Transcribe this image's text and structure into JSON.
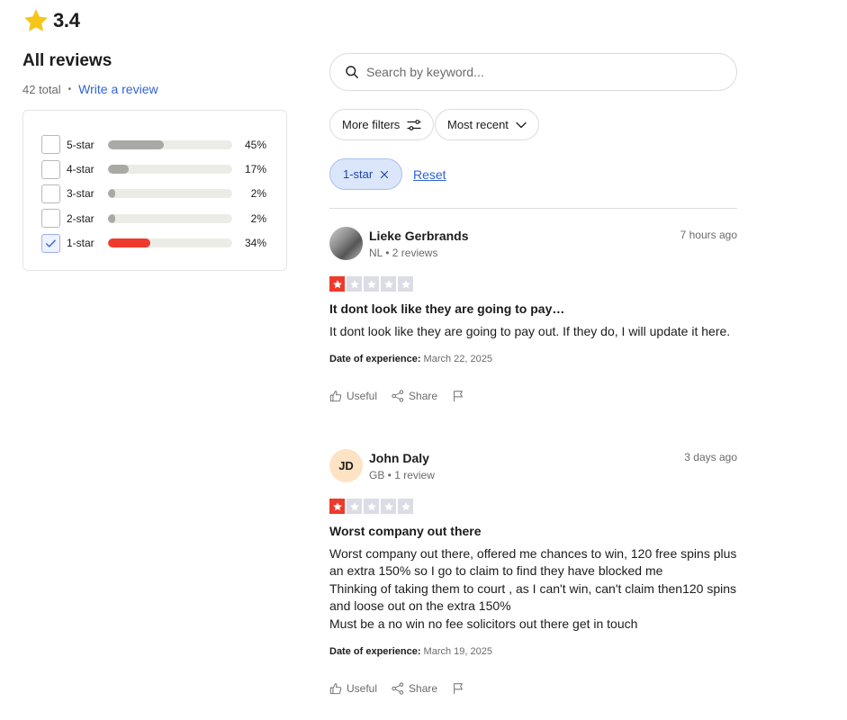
{
  "summary": {
    "rating": "3.4",
    "title": "All reviews",
    "total": "42 total",
    "separator": "•",
    "write_review": "Write a review"
  },
  "filters": [
    {
      "label": "5-star",
      "percent": "45%",
      "fill": 0.45,
      "checked": false
    },
    {
      "label": "4-star",
      "percent": "17%",
      "fill": 0.17,
      "checked": false
    },
    {
      "label": "3-star",
      "percent": "2%",
      "fill": 0.06,
      "checked": false
    },
    {
      "label": "2-star",
      "percent": "2%",
      "fill": 0.06,
      "checked": false
    },
    {
      "label": "1-star",
      "percent": "34%",
      "fill": 0.34,
      "checked": true
    }
  ],
  "search": {
    "placeholder": "Search by keyword..."
  },
  "controls": {
    "more_filters": "More filters",
    "sort": "Most recent",
    "active_chip": "1-star",
    "reset": "Reset"
  },
  "reviews": [
    {
      "name": "Lieke Gerbrands",
      "meta": "NL • 2 reviews",
      "time": "7 hours ago",
      "stars": 1,
      "title": "It dont look like they are going to pay…",
      "body": "It dont look like they are going to pay out. If they do, I will update it here.",
      "date_label": "Date of experience:",
      "date": "March 22, 2025",
      "useful": "Useful",
      "share": "Share"
    },
    {
      "name": "John Daly",
      "initials": "JD",
      "meta": "GB • 1 review",
      "time": "3 days ago",
      "stars": 1,
      "title": "Worst company out there",
      "body": "Worst company out there, offered me chances to win, 120 free spins plus an extra 150% so I go to claim to find they have blocked me\nThinking of taking them to court , as I can't win, can't claim then120 spins and loose out on the extra 150%\nMust be a no win no fee solicitors out there get in touch",
      "date_label": "Date of experience:",
      "date": "March 19, 2025",
      "useful": "Useful",
      "share": "Share"
    }
  ],
  "colors": {
    "accent_blue": "#2f63d6",
    "star_yellow": "#f5c518",
    "one_star_red": "#ee3a2c",
    "bar_gray": "#a9a9a5"
  }
}
